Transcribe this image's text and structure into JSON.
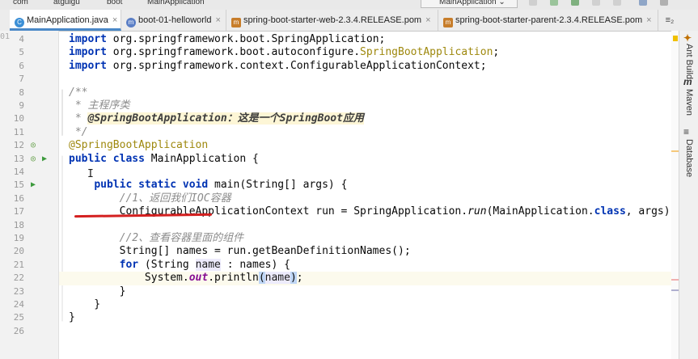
{
  "breadcrumb": {
    "items": [
      "com",
      "atguigu",
      "boot",
      "MainApplication"
    ],
    "run_config": "MainApplication"
  },
  "tabs": [
    {
      "label": "MainApplication.java",
      "active": true,
      "icon_name": "java-class-icon",
      "icon_color": "#3b8fd6"
    },
    {
      "label": "boot-01-helloworld",
      "active": false,
      "icon_name": "maven-module-icon",
      "icon_color": "#5b7fc6"
    },
    {
      "label": "spring-boot-starter-web-2.3.4.RELEASE.pom",
      "active": false,
      "icon_name": "xml-file-icon",
      "icon_color": "#c77d2a"
    },
    {
      "label": "spring-boot-starter-parent-2.3.4.RELEASE.pom",
      "active": false,
      "icon_name": "xml-file-icon",
      "icon_color": "#c77d2a"
    }
  ],
  "tab_menu": "≡₂",
  "gutter_top_number": "01",
  "code_lines": [
    {
      "n": "4",
      "segments": [
        {
          "t": "import",
          "c": "kw"
        },
        {
          "t": " org.springframework.boot.SpringApplication;",
          "c": ""
        }
      ]
    },
    {
      "n": "5",
      "segments": [
        {
          "t": "import",
          "c": "kw"
        },
        {
          "t": " org.springframework.boot.autoconfigure.",
          "c": ""
        },
        {
          "t": "SpringBootApplication",
          "c": "ann"
        },
        {
          "t": ";",
          "c": ""
        }
      ]
    },
    {
      "n": "6",
      "segments": [
        {
          "t": "import",
          "c": "kw"
        },
        {
          "t": " org.springframework.context.ConfigurableApplicationContext;",
          "c": ""
        }
      ]
    },
    {
      "n": "7",
      "segments": []
    },
    {
      "n": "8",
      "segments": [
        {
          "t": "/**",
          "c": "doc"
        }
      ]
    },
    {
      "n": "9",
      "segments": [
        {
          "t": " * 主程序类",
          "c": "doc"
        }
      ]
    },
    {
      "n": "10",
      "segments": [
        {
          "t": " * ",
          "c": "doc"
        },
        {
          "t": "@SpringBootApplication：这是一个SpringBoot应用",
          "c": "doctag"
        }
      ]
    },
    {
      "n": "11",
      "segments": [
        {
          "t": " */",
          "c": "doc"
        }
      ]
    },
    {
      "n": "12",
      "segments": [
        {
          "t": "@SpringBootApplication",
          "c": "ann"
        }
      ]
    },
    {
      "n": "13",
      "segments": [
        {
          "t": "public class",
          "c": "kw"
        },
        {
          "t": " MainApplication {",
          "c": ""
        }
      ]
    },
    {
      "n": "14",
      "segments": []
    },
    {
      "n": "15",
      "segments": [
        {
          "t": "    ",
          "c": ""
        },
        {
          "t": "public static void",
          "c": "kw"
        },
        {
          "t": " main(String[] args) {",
          "c": ""
        }
      ]
    },
    {
      "n": "16",
      "segments": [
        {
          "t": "        ",
          "c": ""
        },
        {
          "t": "//1、返回我们IOC容器",
          "c": "cm"
        }
      ]
    },
    {
      "n": "17",
      "segments": [
        {
          "t": "        ConfigurableApplicationContext run = SpringApplication.",
          "c": ""
        },
        {
          "t": "run",
          "c": "ital"
        },
        {
          "t": "(MainApplication.",
          "c": ""
        },
        {
          "t": "class",
          "c": "kw"
        },
        {
          "t": ", args);",
          "c": ""
        }
      ]
    },
    {
      "n": "18",
      "segments": []
    },
    {
      "n": "19",
      "segments": [
        {
          "t": "        ",
          "c": ""
        },
        {
          "t": "//2、查看容器里面的组件",
          "c": "cm"
        }
      ]
    },
    {
      "n": "20",
      "segments": [
        {
          "t": "        String[] names = run.getBeanDefinitionNames();",
          "c": ""
        }
      ]
    },
    {
      "n": "21",
      "segments": [
        {
          "t": "        ",
          "c": ""
        },
        {
          "t": "for",
          "c": "kw"
        },
        {
          "t": " (String ",
          "c": ""
        },
        {
          "t": "name",
          "c": "var"
        },
        {
          "t": " : names) {",
          "c": ""
        }
      ]
    },
    {
      "n": "22",
      "segments": [
        {
          "t": "            System.",
          "c": ""
        },
        {
          "t": "out",
          "c": "field"
        },
        {
          "t": ".println",
          "c": ""
        },
        {
          "t": "(",
          "c": "paren"
        },
        {
          "t": "name",
          "c": "var"
        },
        {
          "t": ")",
          "c": "paren"
        },
        {
          "t": ";",
          "c": ""
        }
      ]
    },
    {
      "n": "23",
      "segments": [
        {
          "t": "        }",
          "c": ""
        }
      ]
    },
    {
      "n": "24",
      "segments": [
        {
          "t": "    }",
          "c": ""
        }
      ]
    },
    {
      "n": "25",
      "segments": [
        {
          "t": "}",
          "c": ""
        }
      ]
    },
    {
      "n": "26",
      "segments": []
    }
  ],
  "current_line": "22",
  "gutter_icons": [
    {
      "line": "12",
      "name": "spring-bean-icon",
      "glyph": "◎",
      "color": "#5a9a3c"
    },
    {
      "line": "13",
      "name": "spring-bean-icon",
      "glyph": "◎",
      "color": "#5a9a3c"
    },
    {
      "line": "13",
      "name": "run-icon",
      "glyph": "▶",
      "color": "#3c9a3c"
    },
    {
      "line": "15",
      "name": "run-icon",
      "glyph": "▶",
      "color": "#3c9a3c"
    }
  ],
  "right_sidebar": [
    {
      "label": "Ant Build",
      "icon": "ant-icon",
      "glyph": "✦"
    },
    {
      "label": "Maven",
      "icon": "maven-icon",
      "glyph": "m"
    },
    {
      "label": "Database",
      "icon": "database-icon",
      "glyph": "≡"
    }
  ],
  "colors": {
    "keyword": "#0033b3",
    "annotation": "#9e880d",
    "comment": "#8c8c8c",
    "static_field": "#871094",
    "active_tab_underline": "#4a88c7"
  }
}
